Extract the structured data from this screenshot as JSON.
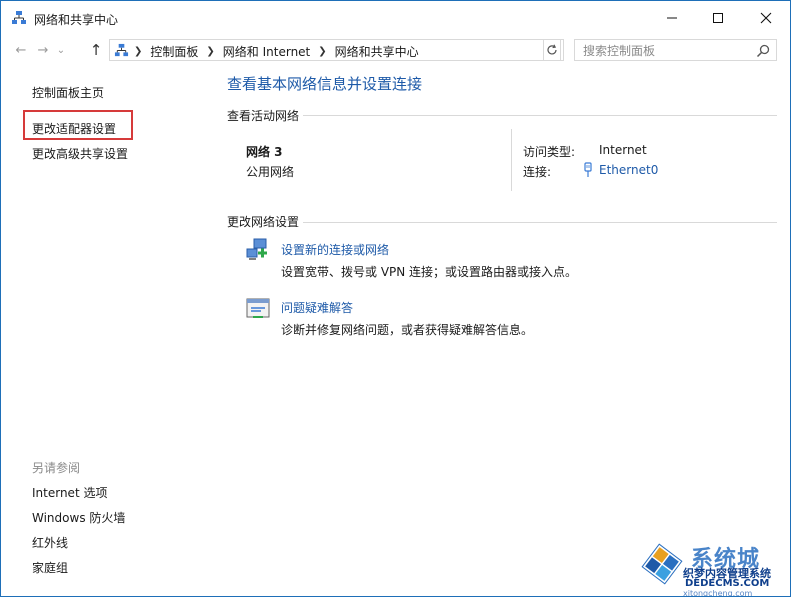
{
  "window": {
    "title": "网络和共享中心",
    "controls": {
      "minimize": "minimize-icon",
      "maximize": "maximize-icon",
      "close": "close-icon"
    }
  },
  "nav": {
    "back_icon": "←",
    "forward_icon": "→",
    "recent_icon": "⌄",
    "up_icon": "↑",
    "breadcrumb": [
      "控制面板",
      "网络和 Internet",
      "网络和共享中心"
    ],
    "search_placeholder": "搜索控制面板"
  },
  "sidebar": {
    "home": "控制面板主页",
    "links": [
      "更改适配器设置",
      "更改高级共享设置"
    ],
    "see_also_title": "另请参阅",
    "see_also": [
      "Internet 选项",
      "Windows 防火墙",
      "红外线",
      "家庭组"
    ]
  },
  "main": {
    "title": "查看基本网络信息并设置连接",
    "active_networks_label": "查看活动网络",
    "network": {
      "name": "网络  3",
      "category": "公用网络",
      "access_type_label": "访问类型:",
      "access_type_value": "Internet",
      "connections_label": "连接:",
      "connection_value": "Ethernet0"
    },
    "change_settings_label": "更改网络设置",
    "tasks": [
      {
        "link": "设置新的连接或网络",
        "desc": "设置宽带、拨号或 VPN 连接；或设置路由器或接入点。",
        "icon": "new-connection-icon"
      },
      {
        "link": "问题疑难解答",
        "desc": "诊断并修复网络问题，或者获得疑难解答信息。",
        "icon": "troubleshoot-icon"
      }
    ]
  },
  "watermark": {
    "big": "系统城",
    "line1": "织梦内容管理系统",
    "line2": "DEDECMS.COM",
    "line3": "xitongcheng.com"
  },
  "colors": {
    "link": "#1e5aa8",
    "highlight": "#d63a3a",
    "frame": "#1e6fb8"
  }
}
